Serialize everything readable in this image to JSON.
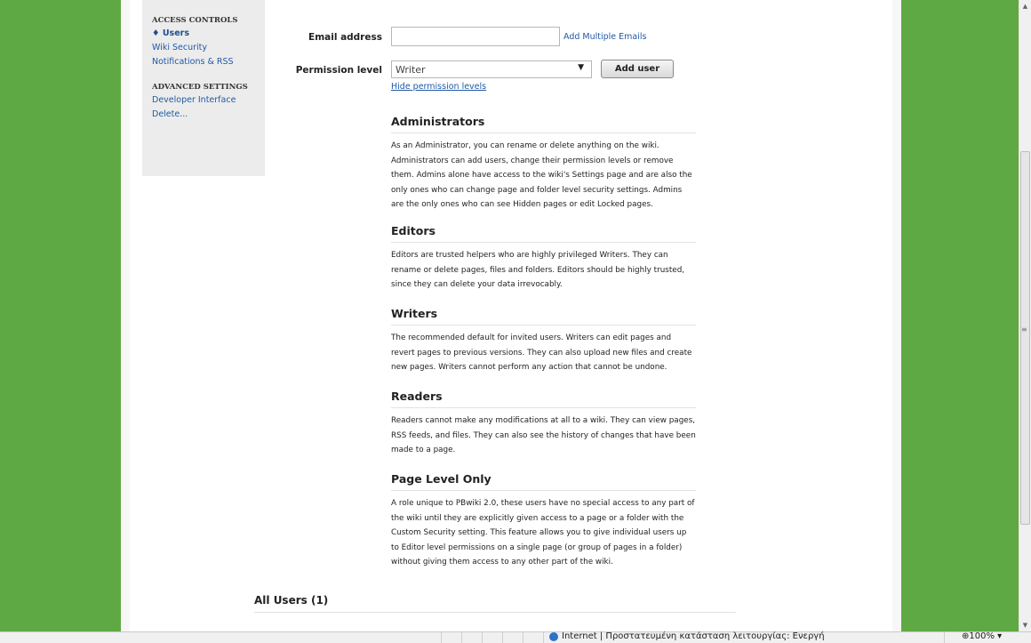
{
  "sidebar": {
    "access_heading": "ACCESS CONTROLS",
    "access_items": [
      {
        "label": "♦ Users"
      },
      {
        "label": "Wiki Security"
      },
      {
        "label": "Notifications & RSS"
      }
    ],
    "advanced_heading": "ADVANCED SETTINGS",
    "advanced_items": [
      {
        "label": "Developer Interface"
      },
      {
        "label": "Delete..."
      }
    ]
  },
  "form": {
    "email_label": "Email address",
    "email_value": "",
    "add_multiple_link": "Add Multiple Emails",
    "permission_label": "Permission level",
    "permission_selected": "Writer",
    "add_user_button": "Add user",
    "hide_levels_link": "Hide permission levels"
  },
  "roles": [
    {
      "title": "Administrators",
      "desc": "As an Administrator, you can rename or delete anything on the wiki. Administrators can add users, change their permission levels or remove them. Admins alone have access to the wiki's Settings page and are also the only ones who can change page and folder level security settings. Admins are the only ones who can see Hidden pages or edit Locked pages."
    },
    {
      "title": "Editors",
      "desc": "Editors are trusted helpers who are highly privileged Writers. They can rename or delete pages, files and folders. Editors should be highly trusted, since they can delete your data irrevocably."
    },
    {
      "title": "Writers",
      "desc": "The recommended default for invited users. Writers can edit pages and revert pages to previous versions. They can also upload new files and create new pages. Writers cannot perform any action that cannot be undone."
    },
    {
      "title": "Readers",
      "desc": "Readers cannot make any modifications at all to a wiki. They can view pages, RSS feeds, and files. They can also see the history of changes that have been made to a page."
    },
    {
      "title": "Page Level Only",
      "desc": "A role unique to PBwiki 2.0, these users have no special access to any part of the wiki until they are explicitly given access to a page or a folder with the Custom Security setting. This feature allows you to give individual users up to Editor level permissions on a single page (or group of pages in a folder) without giving them access to any other part of the wiki."
    }
  ],
  "all_users_heading": "All Users (1)",
  "statusbar": {
    "zone_text": "Internet | Προστατευμένη κατάσταση λειτουργίας: Ενεργή",
    "zoom": "⊕100%"
  },
  "colors": {
    "page_bg": "#5fa944",
    "link": "#1f5aa6"
  }
}
